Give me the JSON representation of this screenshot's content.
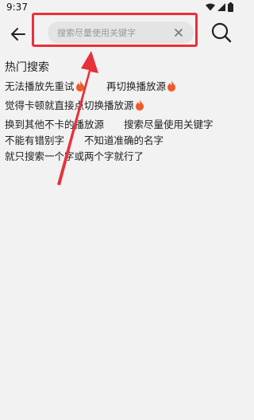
{
  "status": {
    "time": "9:37"
  },
  "search": {
    "placeholder": "搜索尽量使用关键字",
    "value": ""
  },
  "hot": {
    "title": "热门搜索",
    "tags": [
      {
        "label": "无法播放先重试",
        "hot": true
      },
      {
        "label": "再切换播放源",
        "hot": true
      },
      {
        "label": "觉得卡顿就直接点切换播放源",
        "hot": true
      },
      {
        "label": "换到其他不卡的播放源",
        "hot": false
      },
      {
        "label": "搜索尽量使用关键字",
        "hot": false
      },
      {
        "label": "不能有错别字",
        "hot": false
      },
      {
        "label": "不知道准确的名字",
        "hot": false
      },
      {
        "label": "就只搜索一个字或两个字就行了",
        "hot": false
      }
    ]
  },
  "colors": {
    "highlight": "#e8303a",
    "fire": "#f05a28"
  }
}
